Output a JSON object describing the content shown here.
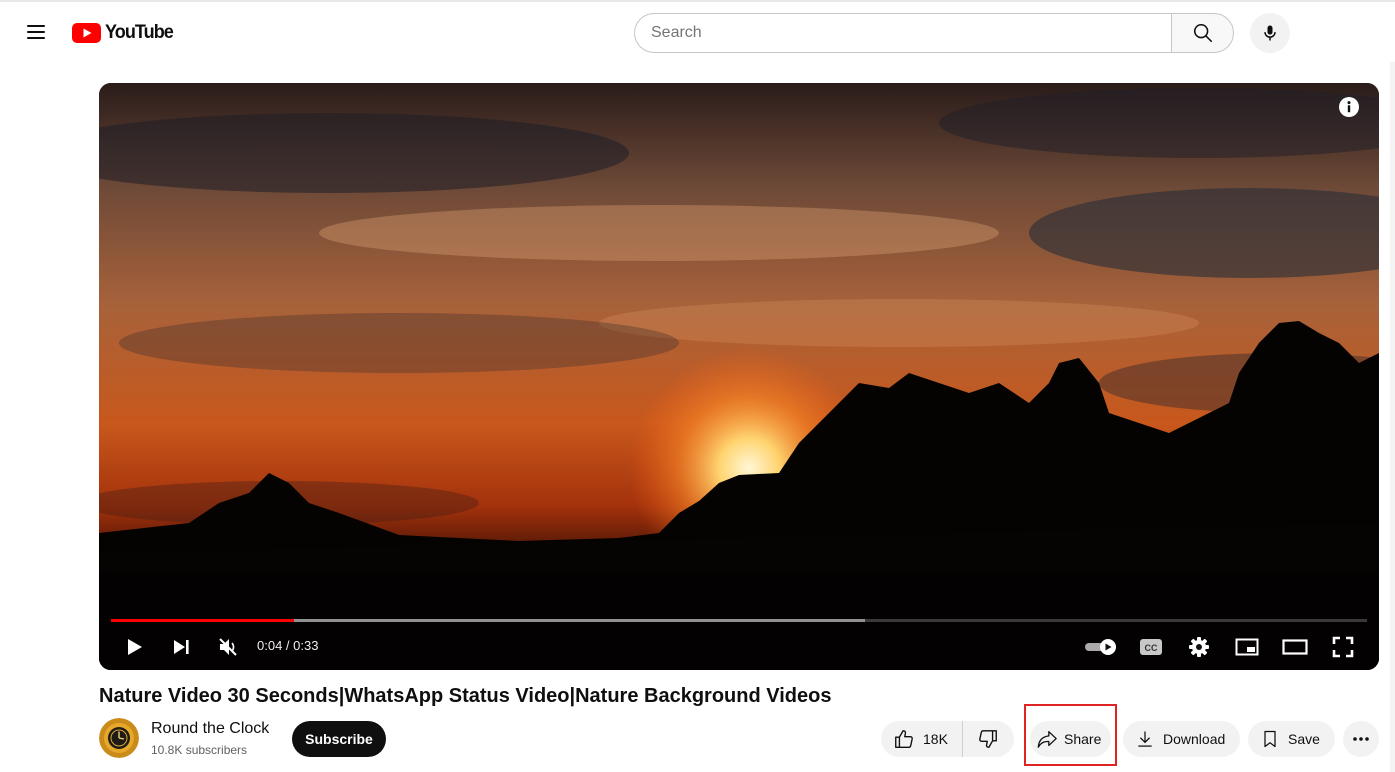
{
  "header": {
    "logo_text": "YouTube",
    "search_placeholder": "Search",
    "icons": [
      "menu-icon",
      "youtube-logo",
      "search-icon",
      "mic-icon"
    ]
  },
  "player": {
    "current_time": "0:04",
    "duration": "0:33",
    "time_display": "0:04 / 0:33",
    "played_fraction": 0.146,
    "buffered_fraction": 0.6,
    "autoplay": true,
    "muted": true,
    "icons": [
      "info-icon",
      "play-icon",
      "next-icon",
      "mute-icon",
      "autoplay-toggle-icon",
      "captions-icon",
      "settings-icon",
      "miniplayer-icon",
      "theater-icon",
      "fullscreen-icon"
    ]
  },
  "video": {
    "title": "Nature Video 30 Seconds|WhatsApp Status Video|Nature Background Videos"
  },
  "channel": {
    "name": "Round the Clock",
    "subscribers": "10.8K subscribers",
    "subscribe_label": "Subscribe"
  },
  "actions": {
    "like_count": "18K",
    "share_label": "Share",
    "download_label": "Download",
    "save_label": "Save"
  },
  "colors": {
    "accent": "#ff0000",
    "highlight_box": "#e02424",
    "chip_bg": "#f2f2f2"
  }
}
